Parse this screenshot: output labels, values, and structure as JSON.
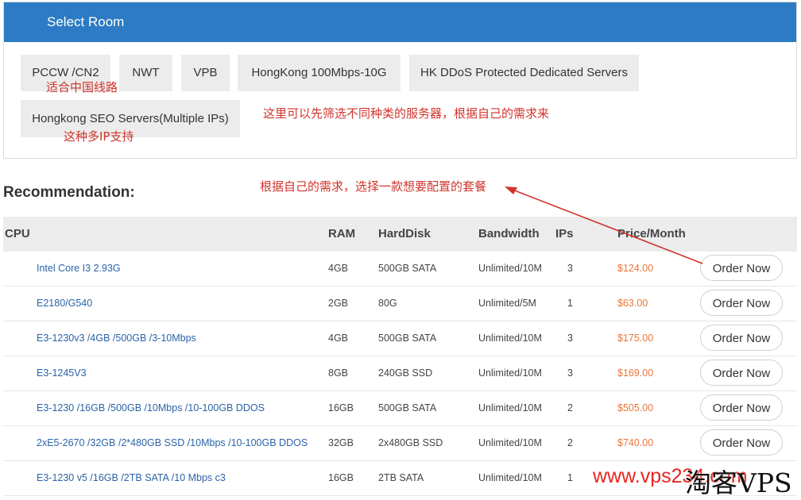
{
  "room_panel": {
    "title": "Select Room",
    "rooms": [
      "PCCW /CN2",
      "NWT",
      "VPB",
      "HongKong 100Mbps-10G",
      "HK DDoS Protected Dedicated Servers",
      "Hongkong SEO Servers(Multiple IPs)"
    ]
  },
  "annotations": {
    "pccw_note": "适合中国线路",
    "seo_note": "这种多IP支持",
    "filter_note": "这里可以先筛选不同种类的服务器，根据自己的需求来",
    "select_note": "根据自己的需求，选择一款想要配置的套餐"
  },
  "recommendation": {
    "title": "Recommendation:",
    "headers": {
      "cpu": "CPU",
      "ram": "RAM",
      "harddisk": "HardDisk",
      "bandwidth": "Bandwidth",
      "ips": "IPs",
      "price": "Price/Month"
    },
    "rows": [
      {
        "cpu": "Intel Core I3 2.93G",
        "ram": "4GB",
        "disk": "500GB SATA",
        "bandwidth": "Unlimited/10M",
        "ips": "3",
        "price": "$124.00",
        "action": "Order Now"
      },
      {
        "cpu": "E2180/G540",
        "ram": "2GB",
        "disk": "80G",
        "bandwidth": "Unlimited/5M",
        "ips": "1",
        "price": "$63.00",
        "action": "Order Now"
      },
      {
        "cpu": "E3-1230v3 /4GB /500GB /3-10Mbps",
        "ram": "4GB",
        "disk": "500GB SATA",
        "bandwidth": "Unlimited/10M",
        "ips": "3",
        "price": "$175.00",
        "action": "Order Now"
      },
      {
        "cpu": "E3-1245V3",
        "ram": "8GB",
        "disk": "240GB SSD",
        "bandwidth": "Unlimited/10M",
        "ips": "3",
        "price": "$169.00",
        "action": "Order Now"
      },
      {
        "cpu": "E3-1230 /16GB /500GB /10Mbps /10-100GB DDOS",
        "ram": "16GB",
        "disk": "500GB SATA",
        "bandwidth": "Unlimited/10M",
        "ips": "2",
        "price": "$505.00",
        "action": "Order Now"
      },
      {
        "cpu": "2xE5-2670 /32GB /2*480GB SSD /10Mbps /10-100GB DDOS",
        "ram": "32GB",
        "disk": "2x480GB SSD",
        "bandwidth": "Unlimited/10M",
        "ips": "2",
        "price": "$740.00",
        "action": "Order Now"
      },
      {
        "cpu": "E3-1230 v5 /16GB /2TB SATA /10 Mbps c3",
        "ram": "16GB",
        "disk": "2TB SATA",
        "bandwidth": "Unlimited/10M",
        "ips": "1",
        "price": "",
        "action": ""
      }
    ]
  },
  "watermark": {
    "url": "www.vps234.com",
    "name": "淘客VPS"
  },
  "colors": {
    "header_blue": "#2d7bc4",
    "link_blue": "#2b63a8",
    "price_orange": "#e8763a",
    "annotation_red": "#d0342c"
  }
}
